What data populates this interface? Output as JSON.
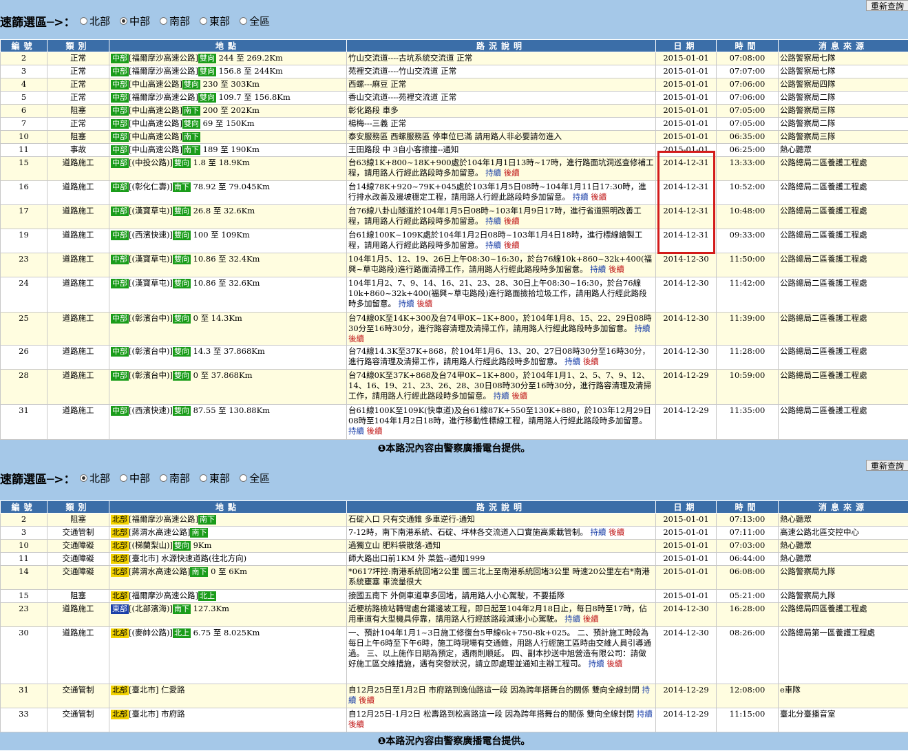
{
  "panel1": {
    "filter_label": "速篩選區─>：",
    "refresh_label": "重新查詢",
    "regions": [
      {
        "label": "北部",
        "selected": false
      },
      {
        "label": "中部",
        "selected": true
      },
      {
        "label": "南部",
        "selected": false
      },
      {
        "label": "東部",
        "selected": false
      },
      {
        "label": "全區",
        "selected": false
      }
    ],
    "headers": [
      "編號",
      "類別",
      "地點",
      "路況說明",
      "日期",
      "時間",
      "消息來源"
    ],
    "rows": [
      {
        "no": "2",
        "cat": "正常",
        "region": "中部",
        "road": "[福爾摩沙高速公路]",
        "dir": "雙向",
        "km": "244 至 269.2Km",
        "desc": "竹山交流道----古坑系統交流道 正常",
        "date": "2015-01-01",
        "time": "07:08:00",
        "src": "公路警察局七隊",
        "more": false
      },
      {
        "no": "3",
        "cat": "正常",
        "region": "中部",
        "road": "[福爾摩沙高速公路]",
        "dir": "雙向",
        "km": "156.8 至 244Km",
        "desc": "苑裡交流道----竹山交流道 正常",
        "date": "2015-01-01",
        "time": "07:07:00",
        "src": "公路警察局七隊",
        "more": false
      },
      {
        "no": "4",
        "cat": "正常",
        "region": "中部",
        "road": "[中山高速公路]",
        "dir": "雙向",
        "km": "230 至 303Km",
        "desc": "西螺---麻豆 正常",
        "date": "2015-01-01",
        "time": "07:06:00",
        "src": "公路警察局四隊",
        "more": false
      },
      {
        "no": "5",
        "cat": "正常",
        "region": "中部",
        "road": "[福爾摩沙高速公路]",
        "dir": "雙向",
        "km": "109.7 至 156.8Km",
        "desc": "香山交流道----苑裡交流道 正常",
        "date": "2015-01-01",
        "time": "07:06:00",
        "src": "公路警察局二隊",
        "more": false
      },
      {
        "no": "6",
        "cat": "阻塞",
        "region": "中部",
        "road": "[中山高速公路]",
        "dir": "南下",
        "km": "200 至 202Km",
        "desc": "彰化路段 車多",
        "date": "2015-01-01",
        "time": "07:05:00",
        "src": "公路警察局三隊",
        "more": false
      },
      {
        "no": "7",
        "cat": "正常",
        "region": "中部",
        "road": "[中山高速公路]",
        "dir": "雙向",
        "km": "69 至 150Km",
        "desc": "楊梅---三義 正常",
        "date": "2015-01-01",
        "time": "07:05:00",
        "src": "公路警察局二隊",
        "more": false
      },
      {
        "no": "10",
        "cat": "阻塞",
        "region": "中部",
        "road": "[中山高速公路]",
        "dir": "南下",
        "km": "",
        "desc": "泰安服務區 西螺服務區 停車位已滿 請用路人非必要請勿進入",
        "date": "2015-01-01",
        "time": "06:35:00",
        "src": "公路警察局三隊",
        "more": false
      },
      {
        "no": "11",
        "cat": "事故",
        "region": "中部",
        "road": "[中山高速公路]",
        "dir": "南下",
        "km": "189 至 190Km",
        "desc": "王田路段 中 3自小客擦撞--通知",
        "date": "2015-01-01",
        "time": "06:25:00",
        "src": "熱心聽眾",
        "more": false
      },
      {
        "no": "15",
        "cat": "道路施工",
        "region": "中部",
        "road": "[(中投公路)]",
        "dir": "雙向",
        "km": "1.8 至 18.9Km",
        "desc": "台63線1K+800~18K+900處於104年1月1日13時~17時，進行路面坑洞巡查修補工程，請用路人行經此路段時多加留意。",
        "date": "2014-12-31",
        "time": "13:33:00",
        "src": "公路總局二區養護工程處",
        "more": true
      },
      {
        "no": "16",
        "cat": "道路施工",
        "region": "中部",
        "road": "[(彰化仁壽)]",
        "dir": "南下",
        "km": "78.92 至 79.045Km",
        "desc": "台14線78K+920~79K+045處於103年1月5日08時~104年1月11日17:30時，進行排水改善及邊坡穩定工程，請用路人行經此路段時多加留意。",
        "date": "2014-12-31",
        "time": "10:52:00",
        "src": "公路總局二區養護工程處",
        "more": true
      },
      {
        "no": "17",
        "cat": "道路施工",
        "region": "中部",
        "road": "[(漢寶草屯)]",
        "dir": "雙向",
        "km": "26.8 至 32.6Km",
        "desc": "台76線八卦山隧道於104年1月5日08時~103年1月9日17時，進行省道照明改善工程，請用路人行經此路段時多加留意。",
        "date": "2014-12-31",
        "time": "10:48:00",
        "src": "公路總局二區養護工程處",
        "more": true
      },
      {
        "no": "19",
        "cat": "道路施工",
        "region": "中部",
        "road": "[(西濱快速)]",
        "dir": "雙向",
        "km": "100 至 109Km",
        "desc": "台61線100K~109K處於104年1月2日08時~103年1月4日18時，進行標線繪製工程，請用路人行經此路段時多加留意。",
        "date": "2014-12-31",
        "time": "09:33:00",
        "src": "公路總局二區養護工程處",
        "more": true
      },
      {
        "no": "23",
        "cat": "道路施工",
        "region": "中部",
        "road": "[(漢寶草屯)]",
        "dir": "雙向",
        "km": "10.86 至 32.4Km",
        "desc": "104年1月5、12、19、26日上午08:30~16:30，於台76線10k+860~32k+400(福興~草屯路段)進行路面清掃工作，請用路人行經此路段時多加留意。",
        "date": "2014-12-30",
        "time": "11:50:00",
        "src": "公路總局二區養護工程處",
        "more": true
      },
      {
        "no": "24",
        "cat": "道路施工",
        "region": "中部",
        "road": "[(漢寶草屯)]",
        "dir": "雙向",
        "km": "10.86 至 32.6Km",
        "desc": "104年1月2、7、9、14、16、21、23、28、30日上午08:30~16:30，於台76線10k+860~32k+400(福興~草屯路段)進行路面撿拾垃圾工作，請用路人行經此路段時多加留意。",
        "date": "2014-12-30",
        "time": "11:42:00",
        "src": "公路總局二區養護工程處",
        "more": true
      },
      {
        "no": "25",
        "cat": "道路施工",
        "region": "中部",
        "road": "[(彰濱台中)]",
        "dir": "雙向",
        "km": "0 至 14.3Km",
        "desc": "台74線0K至14K+300及台74甲0K~1K+800，於104年1月8、15、22、29日08時30分至16時30分，進行路容清理及清掃工作，請用路人行經此路段時多加留意。",
        "date": "2014-12-30",
        "time": "11:39:00",
        "src": "公路總局二區養護工程處",
        "more": true
      },
      {
        "no": "26",
        "cat": "道路施工",
        "region": "中部",
        "road": "[(彰濱台中)]",
        "dir": "雙向",
        "km": "14.3 至 37.868Km",
        "desc": "台74線14.3K至37K+868，於104年1月6、13、20、27日08時30分至16時30分，進行路容清理及清掃工作，請用路人行經此路段時多加留意。",
        "date": "2014-12-30",
        "time": "11:28:00",
        "src": "公路總局二區養護工程處",
        "more": true
      },
      {
        "no": "28",
        "cat": "道路施工",
        "region": "中部",
        "road": "[(彰濱台中)]",
        "dir": "雙向",
        "km": "0 至 37.868Km",
        "desc": "台74線0K至37K+868及台74甲0K~1K+800，於104年1月1、2、5、7、9、12、14、16、19、21、23、26、28、30日08時30分至16時30分，進行路容清理及清掃工作，請用路人行經此路段時多加留意。",
        "date": "2014-12-29",
        "time": "10:59:00",
        "src": "公路總局二區養護工程處",
        "more": true
      },
      {
        "no": "31",
        "cat": "道路施工",
        "region": "中部",
        "road": "[(西濱快速)]",
        "dir": "雙向",
        "km": "87.55 至 130.88Km",
        "desc": "台61線100K至109K(快車道)及台61線87K+550至130K+880，於103年12月29日08時至104年1月2日18時，進行移動性標線工程，請用路人行經此路段時多加留意。",
        "date": "2014-12-29",
        "time": "11:35:00",
        "src": "公路總局二區養護工程處",
        "more": true
      }
    ],
    "footer": "❶本路況內容由警察廣播電台提供。"
  },
  "panel2": {
    "filter_label": "速篩選區─>：",
    "refresh_label": "重新查詢",
    "regions": [
      {
        "label": "北部",
        "selected": true
      },
      {
        "label": "中部",
        "selected": false
      },
      {
        "label": "南部",
        "selected": false
      },
      {
        "label": "東部",
        "selected": false
      },
      {
        "label": "全區",
        "selected": false
      }
    ],
    "headers": [
      "編號",
      "類別",
      "地點",
      "路況說明",
      "日期",
      "時間",
      "消息來源"
    ],
    "rows": [
      {
        "no": "2",
        "cat": "阻塞",
        "region": "北部",
        "road": "[福爾摩沙高速公路]",
        "dir": "南下",
        "km": "",
        "desc": "石碇入口 只有交通錐 多車逆行-通知",
        "date": "2015-01-01",
        "time": "07:13:00",
        "src": "熱心聽眾",
        "more": false
      },
      {
        "no": "3",
        "cat": "交通管制",
        "region": "北部",
        "road": "[蔣渭水高速公路]",
        "dir": "南下",
        "km": "",
        "desc": "7-12時，南下南港系統、石碇、坪林各交流道入口實施高乘載管制。",
        "date": "2015-01-01",
        "time": "07:11:00",
        "src": "高速公路北區交控中心",
        "more": true
      },
      {
        "no": "10",
        "cat": "交通障礙",
        "region": "北部",
        "road": "[(梯蘭梨山)]",
        "dir": "雙向",
        "km": "9Km",
        "desc": "過獨立山 肥料袋散落-通知",
        "date": "2015-01-01",
        "time": "07:03:00",
        "src": "熱心聽眾",
        "more": false
      },
      {
        "no": "11",
        "cat": "交通障礙",
        "region": "北部",
        "road": "[臺北市]",
        "dir": "",
        "km": "水源快速道路(往北方向)",
        "desc": "師大路出口前1KM 外 菜籃--通知1999",
        "date": "2015-01-01",
        "time": "06:44:00",
        "src": "熱心聽眾",
        "more": false
      },
      {
        "no": "14",
        "cat": "交通障礙",
        "region": "北部",
        "road": "[蔣渭水高速公路]",
        "dir": "南下",
        "km": "0 至 6Km",
        "desc": "*0617坪控:南港系統回堵2公里 國三北上至南港系統回堵3公里 時速20公里左右*南港系統壅塞 車流量很大",
        "date": "2015-01-01",
        "time": "06:08:00",
        "src": "公路警察局九隊",
        "more": false
      },
      {
        "no": "15",
        "cat": "阻塞",
        "region": "北部",
        "road": "[福爾摩沙高速公路]",
        "dir": "北上",
        "km": "",
        "desc": "接國五南下 外側車道車多回堵，請用路人小心駕駛，不要插隊",
        "date": "2015-01-01",
        "time": "05:21:00",
        "src": "公路警察局九隊",
        "more": false
      },
      {
        "no": "23",
        "cat": "道路施工",
        "region": "東部",
        "road": "[(北部濱海)]",
        "dir": "南下",
        "km": "127.3Km",
        "desc": "近梗枋路檢站轉彎處台鐵邊坡工程，即日起至104年2月18日止，每日8時至17時，佔用車道有大型機具停靠，請用路人行經該路段減速小心駕駛。",
        "date": "2014-12-30",
        "time": "16:28:00",
        "src": "公路總局四區養護工程處",
        "more": true
      },
      {
        "no": "30",
        "cat": "道路施工",
        "region": "北部",
        "road": "[(麥帥公路)]",
        "dir": "北上",
        "km": "6.75 至 8.025Km",
        "desc": "一、預計104年1月1~3日施工修復台5甲線6k+750-8k+025。 二、預計施工時段為每日上午6時至下午6時，施工時現場有交通錐，用路人行經施工區時由交維人員引導通過。 三、以上施作日期為預定，遇雨則順延。 四、副本抄送中旭營造有限公司：請做好施工區交維措施，遇有突發狀況，請立即處理並通知主辦工程司。",
        "date": "2014-12-30",
        "time": "08:26:00",
        "src": "公路總局第一區養護工程處",
        "more": true
      },
      {
        "no": "31",
        "cat": "交通管制",
        "region": "北部",
        "road": "[臺北市]",
        "dir": "",
        "km": "仁愛路",
        "desc": "自12月25日至1月2日 市府路到逸仙路這一段 因為跨年搭舞台的關係 雙向全線封閉",
        "date": "2014-12-29",
        "time": "12:08:00",
        "src": "e車隊",
        "more": true
      },
      {
        "no": "33",
        "cat": "交通管制",
        "region": "北部",
        "road": "[臺北市]",
        "dir": "",
        "km": "市府路",
        "desc": "自12月25日-1月2日 松壽路到松高路這一段 因為跨年搭舞台的關係 雙向全線封閉",
        "date": "2014-12-29",
        "time": "11:15:00",
        "src": "臺北分臺播音室",
        "more": true
      }
    ],
    "footer": "❶本路況內容由警察廣播電台提供。"
  },
  "links": {
    "more": "持續",
    "later": "後續"
  },
  "colors": {
    "header_bg": "#3b6ea8",
    "bar_bg": "#a5c8e8",
    "odd_row": "#fffde0",
    "mid_tag": "#1a9c1a",
    "north_tag": "#f2d200",
    "east_tag": "#1a3fa8",
    "highlight": "#d31b1b"
  }
}
